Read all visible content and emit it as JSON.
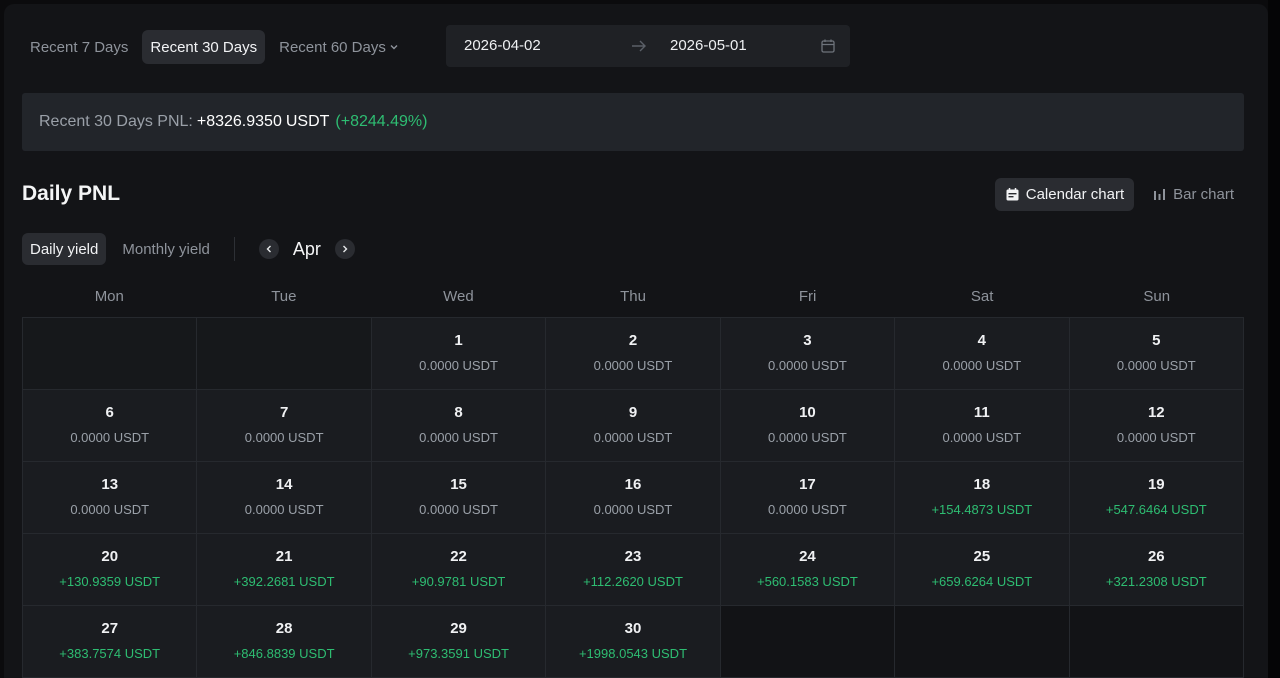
{
  "ranges": [
    {
      "label": "Recent 7 Days",
      "active": false
    },
    {
      "label": "Recent 30 Days",
      "active": true
    },
    {
      "label": "Recent 60 Days",
      "active": false
    }
  ],
  "date_range": {
    "start": "2026-04-02",
    "end": "2026-05-01"
  },
  "pnl": {
    "label": "Recent 30 Days PNL:",
    "value": "+8326.9350",
    "unit": "USDT",
    "pct": "(+8244.49%)"
  },
  "section_title": "Daily PNL",
  "chart_toggle": {
    "calendar": "Calendar chart",
    "bar": "Bar chart"
  },
  "yield_tabs": {
    "daily": "Daily yield",
    "monthly": "Monthly yield"
  },
  "month": "Apr",
  "weekdays": [
    "Mon",
    "Tue",
    "Wed",
    "Thu",
    "Fri",
    "Sat",
    "Sun"
  ],
  "days": [
    {
      "day": "1",
      "value": "0.0000 USDT"
    },
    {
      "day": "2",
      "value": "0.0000 USDT"
    },
    {
      "day": "3",
      "value": "0.0000 USDT"
    },
    {
      "day": "4",
      "value": "0.0000 USDT"
    },
    {
      "day": "5",
      "value": "0.0000 USDT"
    },
    {
      "day": "6",
      "value": "0.0000 USDT"
    },
    {
      "day": "7",
      "value": "0.0000 USDT"
    },
    {
      "day": "8",
      "value": "0.0000 USDT"
    },
    {
      "day": "9",
      "value": "0.0000 USDT"
    },
    {
      "day": "10",
      "value": "0.0000 USDT"
    },
    {
      "day": "11",
      "value": "0.0000 USDT"
    },
    {
      "day": "12",
      "value": "0.0000 USDT"
    },
    {
      "day": "13",
      "value": "0.0000 USDT"
    },
    {
      "day": "14",
      "value": "0.0000 USDT"
    },
    {
      "day": "15",
      "value": "0.0000 USDT"
    },
    {
      "day": "16",
      "value": "0.0000 USDT"
    },
    {
      "day": "17",
      "value": "0.0000 USDT"
    },
    {
      "day": "18",
      "value": "+154.4873 USDT"
    },
    {
      "day": "19",
      "value": "+547.6464 USDT"
    },
    {
      "day": "20",
      "value": "+130.9359 USDT"
    },
    {
      "day": "21",
      "value": "+392.2681 USDT"
    },
    {
      "day": "22",
      "value": "+90.9781 USDT"
    },
    {
      "day": "23",
      "value": "+112.2620 USDT"
    },
    {
      "day": "24",
      "value": "+560.1583 USDT"
    },
    {
      "day": "25",
      "value": "+659.6264 USDT"
    },
    {
      "day": "26",
      "value": "+321.2308 USDT"
    },
    {
      "day": "27",
      "value": "+383.7574 USDT"
    },
    {
      "day": "28",
      "value": "+846.8839 USDT"
    },
    {
      "day": "29",
      "value": "+973.3591 USDT"
    },
    {
      "day": "30",
      "value": "+1998.0543 USDT"
    }
  ],
  "colors": {
    "positive": "#2ebd72",
    "neutral": "#9aa0a8"
  }
}
